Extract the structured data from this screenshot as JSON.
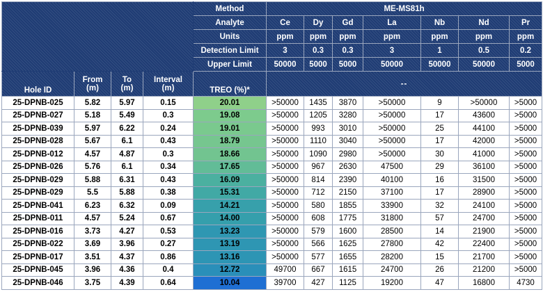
{
  "header": {
    "meta_labels": [
      "Method",
      "Analyte",
      "Units",
      "Detection Limit",
      "Upper Limit"
    ],
    "method_value": "ME-MS81h",
    "analytes": [
      "Ce",
      "Dy",
      "Gd",
      "La",
      "Nb",
      "Nd",
      "Pr"
    ],
    "units": [
      "ppm",
      "ppm",
      "ppm",
      "ppm",
      "ppm",
      "ppm",
      "ppm"
    ],
    "detection_limits": [
      "3",
      "0.3",
      "0.3",
      "3",
      "1",
      "0.5",
      "0.2"
    ],
    "upper_limits": [
      "50000",
      "5000",
      "5000",
      "50000",
      "50000",
      "50000",
      "5000"
    ],
    "col_headers": {
      "hole_id": "Hole ID",
      "from": "From",
      "from_unit": "(m)",
      "to": "To",
      "to_unit": "(m)",
      "interval": "Interval",
      "interval_unit": "(m)",
      "treo": "TREO (%)*",
      "dashes": "--"
    }
  },
  "rows": [
    {
      "hole_id": "25-DPNB-025",
      "from": "5.82",
      "to": "5.97",
      "interval": "0.15",
      "treo": "20.01",
      "ce": ">50000",
      "dy": "1435",
      "gd": "3870",
      "la": ">50000",
      "nb": "9",
      "nd": ">50000",
      "pr": ">5000",
      "color": "#8fd08a"
    },
    {
      "hole_id": "25-DPNB-027",
      "from": "5.18",
      "to": "5.49",
      "interval": "0.3",
      "treo": "19.08",
      "ce": ">50000",
      "dy": "1205",
      "gd": "3280",
      "la": ">50000",
      "nb": "17",
      "nd": "43600",
      "pr": ">5000",
      "color": "#7dcb8d"
    },
    {
      "hole_id": "25-DPNB-039",
      "from": "5.97",
      "to": "6.22",
      "interval": "0.24",
      "treo": "19.01",
      "ce": ">50000",
      "dy": "993",
      "gd": "3010",
      "la": ">50000",
      "nb": "25",
      "nd": "44100",
      "pr": ">5000",
      "color": "#7ac98e"
    },
    {
      "hole_id": "25-DPNB-028",
      "from": "5.67",
      "to": "6.1",
      "interval": "0.43",
      "treo": "18.79",
      "ce": ">50000",
      "dy": "1110",
      "gd": "3040",
      "la": ">50000",
      "nb": "17",
      "nd": "42000",
      "pr": ">5000",
      "color": "#76c68f"
    },
    {
      "hole_id": "25-DPNB-012",
      "from": "4.57",
      "to": "4.87",
      "interval": "0.3",
      "treo": "18.66",
      "ce": ">50000",
      "dy": "1090",
      "gd": "2980",
      "la": ">50000",
      "nb": "30",
      "nd": "41000",
      "pr": ">5000",
      "color": "#72c490"
    },
    {
      "hole_id": "25-DPNB-026",
      "from": "5.76",
      "to": "6.1",
      "interval": "0.34",
      "treo": "17.65",
      "ce": ">50000",
      "dy": "967",
      "gd": "2630",
      "la": "47500",
      "nb": "29",
      "nd": "36100",
      "pr": ">5000",
      "color": "#62bc97"
    },
    {
      "hole_id": "25-DPNB-029",
      "from": "5.88",
      "to": "6.31",
      "interval": "0.43",
      "treo": "16.09",
      "ce": ">50000",
      "dy": "814",
      "gd": "2390",
      "la": "40100",
      "nb": "16",
      "nd": "31500",
      "pr": ">5000",
      "color": "#4bb0a0"
    },
    {
      "hole_id": "25-DPNB-029",
      "from": "5.5",
      "to": "5.88",
      "interval": "0.38",
      "treo": "15.31",
      "ce": ">50000",
      "dy": "712",
      "gd": "2150",
      "la": "37100",
      "nb": "17",
      "nd": "28900",
      "pr": ">5000",
      "color": "#41a9a5"
    },
    {
      "hole_id": "25-DPNB-041",
      "from": "6.23",
      "to": "6.32",
      "interval": "0.09",
      "treo": "14.21",
      "ce": ">50000",
      "dy": "580",
      "gd": "1855",
      "la": "33900",
      "nb": "32",
      "nd": "24100",
      "pr": ">5000",
      "color": "#37a0ab"
    },
    {
      "hole_id": "25-DPNB-011",
      "from": "4.57",
      "to": "5.24",
      "interval": "0.67",
      "treo": "14.00",
      "ce": ">50000",
      "dy": "608",
      "gd": "1775",
      "la": "31800",
      "nb": "57",
      "nd": "24700",
      "pr": ">5000",
      "color": "#359fac"
    },
    {
      "hole_id": "25-DPNB-016",
      "from": "3.73",
      "to": "4.27",
      "interval": "0.53",
      "treo": "13.23",
      "ce": ">50000",
      "dy": "579",
      "gd": "1600",
      "la": "28500",
      "nb": "14",
      "nd": "21900",
      "pr": ">5000",
      "color": "#2f97b2"
    },
    {
      "hole_id": "25-DPNB-022",
      "from": "3.69",
      "to": "3.96",
      "interval": "0.27",
      "treo": "13.19",
      "ce": ">50000",
      "dy": "566",
      "gd": "1625",
      "la": "27800",
      "nb": "42",
      "nd": "22400",
      "pr": ">5000",
      "color": "#2e96b3"
    },
    {
      "hole_id": "25-DPNB-017",
      "from": "3.51",
      "to": "4.37",
      "interval": "0.86",
      "treo": "13.16",
      "ce": ">50000",
      "dy": "577",
      "gd": "1655",
      "la": "28200",
      "nb": "15",
      "nd": "21700",
      "pr": ">5000",
      "color": "#2d95b4"
    },
    {
      "hole_id": "25-DPNB-045",
      "from": "3.96",
      "to": "4.36",
      "interval": "0.4",
      "treo": "12.72",
      "ce": "49700",
      "dy": "667",
      "gd": "1615",
      "la": "24700",
      "nb": "26",
      "nd": "21200",
      "pr": ">5000",
      "color": "#2a8fb9"
    },
    {
      "hole_id": "25-DPNB-046",
      "from": "3.75",
      "to": "4.39",
      "interval": "0.64",
      "treo": "10.04",
      "ce": "39700",
      "dy": "427",
      "gd": "1125",
      "la": "19200",
      "nb": "47",
      "nd": "16800",
      "pr": "4730",
      "color": "#1f6fd3"
    }
  ]
}
